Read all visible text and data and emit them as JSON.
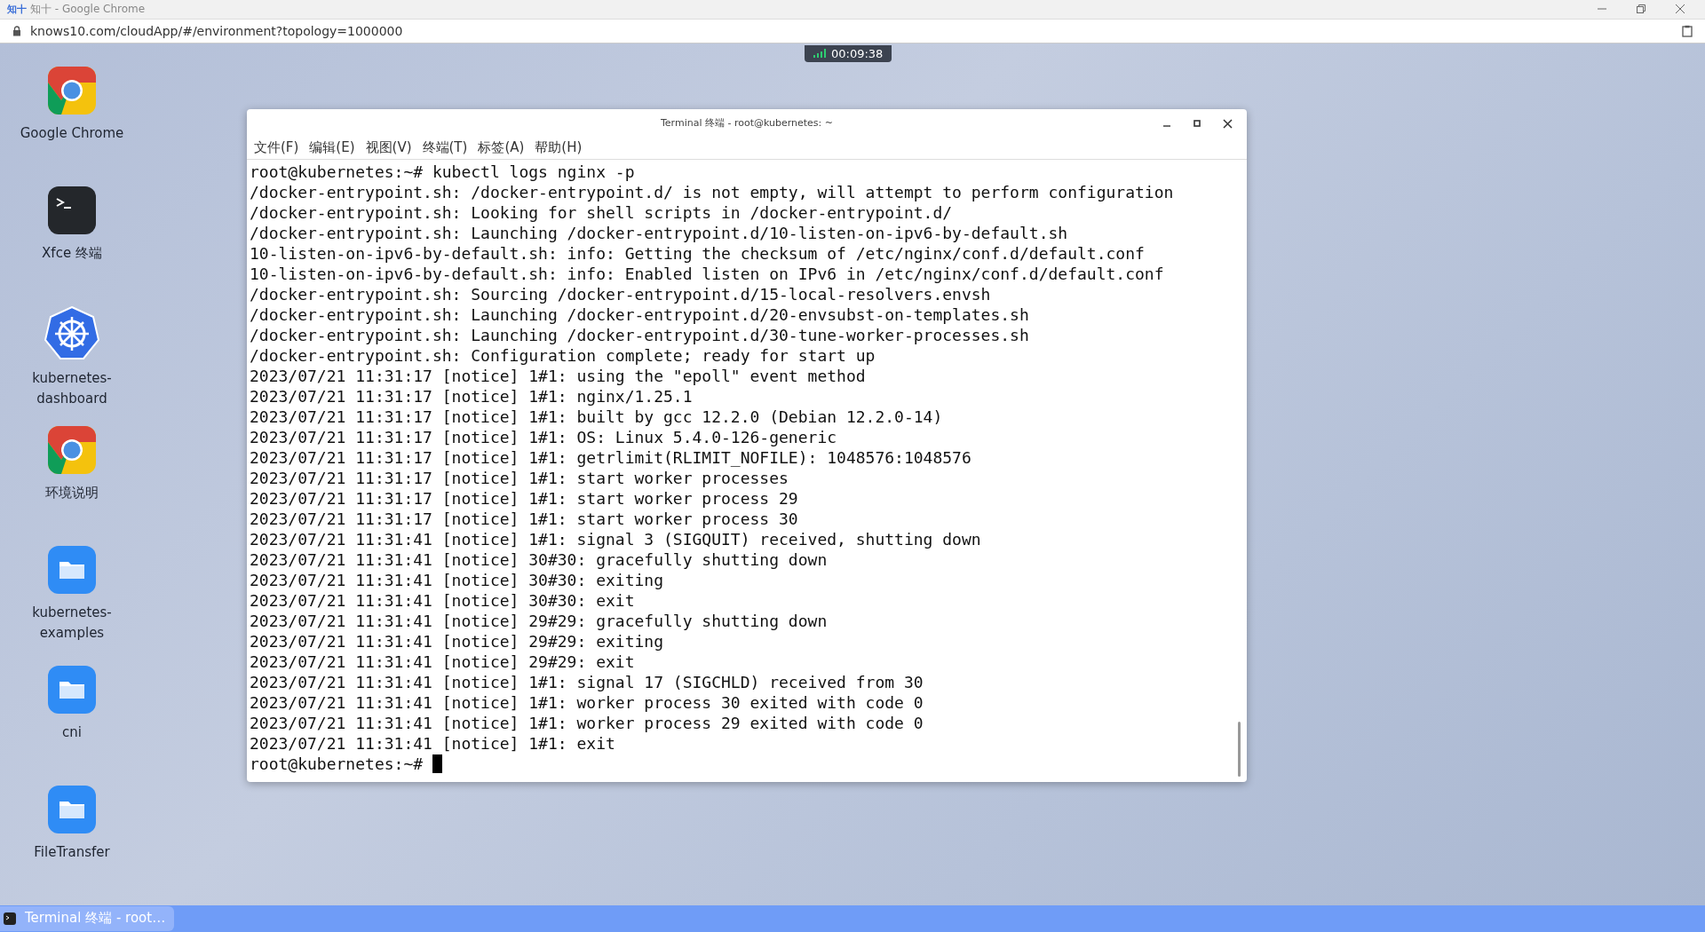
{
  "browser": {
    "favicon": "知十",
    "title": "知十 - Google Chrome",
    "url": "knows10.com/cloudApp/#/environment?topology=1000000"
  },
  "session_timer": "00:09:38",
  "desktop_icons": [
    {
      "kind": "chrome",
      "label": "Google Chrome"
    },
    {
      "kind": "terminal",
      "label": "Xfce 终端"
    },
    {
      "kind": "kubernetes",
      "label": "kubernetes-dashboard"
    },
    {
      "kind": "chrome",
      "label": "环境说明"
    },
    {
      "kind": "folder",
      "label": "kubernetes-examples"
    },
    {
      "kind": "folder",
      "label": "cni"
    },
    {
      "kind": "folder",
      "label": "FileTransfer"
    }
  ],
  "terminal": {
    "title": "Terminal 终端 - root@kubernetes: ~",
    "menu": [
      "文件(F)",
      "编辑(E)",
      "视图(V)",
      "终端(T)",
      "标签(A)",
      "帮助(H)"
    ],
    "lines": [
      "root@kubernetes:~# kubectl logs nginx -p",
      "/docker-entrypoint.sh: /docker-entrypoint.d/ is not empty, will attempt to perform configuration",
      "/docker-entrypoint.sh: Looking for shell scripts in /docker-entrypoint.d/",
      "/docker-entrypoint.sh: Launching /docker-entrypoint.d/10-listen-on-ipv6-by-default.sh",
      "10-listen-on-ipv6-by-default.sh: info: Getting the checksum of /etc/nginx/conf.d/default.conf",
      "10-listen-on-ipv6-by-default.sh: info: Enabled listen on IPv6 in /etc/nginx/conf.d/default.conf",
      "/docker-entrypoint.sh: Sourcing /docker-entrypoint.d/15-local-resolvers.envsh",
      "/docker-entrypoint.sh: Launching /docker-entrypoint.d/20-envsubst-on-templates.sh",
      "/docker-entrypoint.sh: Launching /docker-entrypoint.d/30-tune-worker-processes.sh",
      "/docker-entrypoint.sh: Configuration complete; ready for start up",
      "2023/07/21 11:31:17 [notice] 1#1: using the \"epoll\" event method",
      "2023/07/21 11:31:17 [notice] 1#1: nginx/1.25.1",
      "2023/07/21 11:31:17 [notice] 1#1: built by gcc 12.2.0 (Debian 12.2.0-14)",
      "2023/07/21 11:31:17 [notice] 1#1: OS: Linux 5.4.0-126-generic",
      "2023/07/21 11:31:17 [notice] 1#1: getrlimit(RLIMIT_NOFILE): 1048576:1048576",
      "2023/07/21 11:31:17 [notice] 1#1: start worker processes",
      "2023/07/21 11:31:17 [notice] 1#1: start worker process 29",
      "2023/07/21 11:31:17 [notice] 1#1: start worker process 30",
      "2023/07/21 11:31:41 [notice] 1#1: signal 3 (SIGQUIT) received, shutting down",
      "2023/07/21 11:31:41 [notice] 30#30: gracefully shutting down",
      "2023/07/21 11:31:41 [notice] 30#30: exiting",
      "2023/07/21 11:31:41 [notice] 30#30: exit",
      "2023/07/21 11:31:41 [notice] 29#29: gracefully shutting down",
      "2023/07/21 11:31:41 [notice] 29#29: exiting",
      "2023/07/21 11:31:41 [notice] 29#29: exit",
      "2023/07/21 11:31:41 [notice] 1#1: signal 17 (SIGCHLD) received from 30",
      "2023/07/21 11:31:41 [notice] 1#1: worker process 30 exited with code 0",
      "2023/07/21 11:31:41 [notice] 1#1: worker process 29 exited with code 0",
      "2023/07/21 11:31:41 [notice] 1#1: exit"
    ],
    "prompt": "root@kubernetes:~#"
  },
  "taskbar": [
    {
      "label": "Terminal 终端 - root…",
      "selected": true
    }
  ]
}
